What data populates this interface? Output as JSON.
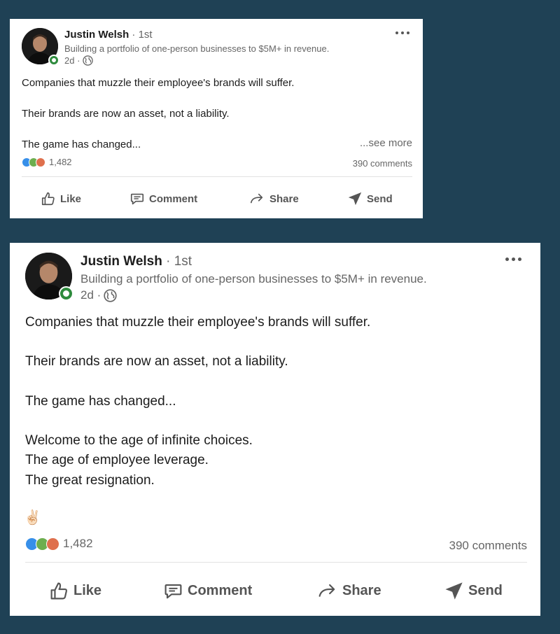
{
  "post_small": {
    "author_name": "Justin Welsh",
    "connection_degree": " · 1st",
    "headline": "Building a portfolio of one-person businesses to $5M+ in revenue.",
    "time": "2d ·",
    "body": "Companies that muzzle their employee's brands will suffer.\n\nTheir brands are now an asset, not a liability.\n\nThe game has changed...",
    "see_more": "...see more",
    "reaction_count": "1,482",
    "comment_count": "390 comments",
    "actions": {
      "like": "Like",
      "comment": "Comment",
      "share": "Share",
      "send": "Send"
    }
  },
  "post_large": {
    "author_name": "Justin Welsh",
    "connection_degree": " · 1st",
    "headline": "Building a portfolio of one-person businesses to $5M+ in revenue.",
    "time": "2d ·",
    "body": "Companies that muzzle their employee's brands will suffer.\n\nTheir brands are now an asset, not a liability.\n\nThe game has changed...\n\nWelcome to the age of infinite choices.\nThe age of employee leverage.\nThe great resignation.",
    "emoji": "✌🏻",
    "reaction_count": "1,482",
    "comment_count": "390 comments",
    "actions": {
      "like": "Like",
      "comment": "Comment",
      "share": "Share",
      "send": "Send"
    }
  },
  "icons": {
    "reactions": [
      "like-reaction-icon",
      "celebrate-reaction-icon",
      "love-reaction-icon"
    ],
    "privacy": "globe-icon",
    "menu": "more-options-icon"
  },
  "colors": {
    "background": "#1f4155",
    "online_indicator": "#2e8b3d",
    "like_reaction": "#378fe9",
    "celebrate_reaction": "#6dae4f",
    "love_reaction": "#df704d"
  }
}
